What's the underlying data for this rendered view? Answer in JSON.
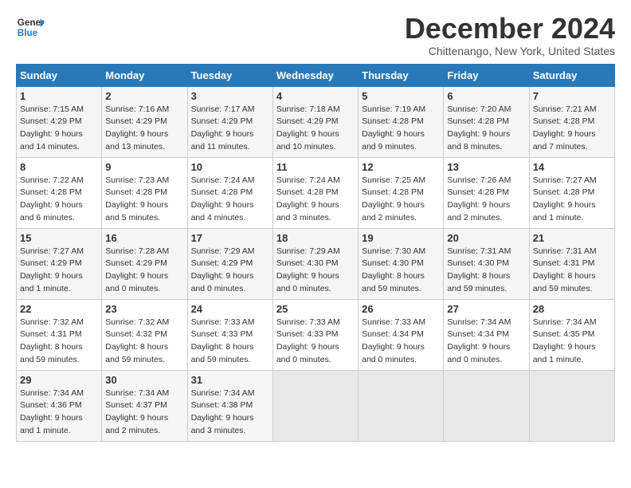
{
  "header": {
    "logo_line1": "General",
    "logo_line2": "Blue",
    "title": "December 2024",
    "subtitle": "Chittenango, New York, United States"
  },
  "days_of_week": [
    "Sunday",
    "Monday",
    "Tuesday",
    "Wednesday",
    "Thursday",
    "Friday",
    "Saturday"
  ],
  "weeks": [
    [
      {
        "day": "1",
        "sunrise": "7:15 AM",
        "sunset": "4:29 PM",
        "daylight": "9 hours and 14 minutes."
      },
      {
        "day": "2",
        "sunrise": "7:16 AM",
        "sunset": "4:29 PM",
        "daylight": "9 hours and 13 minutes."
      },
      {
        "day": "3",
        "sunrise": "7:17 AM",
        "sunset": "4:29 PM",
        "daylight": "9 hours and 11 minutes."
      },
      {
        "day": "4",
        "sunrise": "7:18 AM",
        "sunset": "4:29 PM",
        "daylight": "9 hours and 10 minutes."
      },
      {
        "day": "5",
        "sunrise": "7:19 AM",
        "sunset": "4:28 PM",
        "daylight": "9 hours and 9 minutes."
      },
      {
        "day": "6",
        "sunrise": "7:20 AM",
        "sunset": "4:28 PM",
        "daylight": "9 hours and 8 minutes."
      },
      {
        "day": "7",
        "sunrise": "7:21 AM",
        "sunset": "4:28 PM",
        "daylight": "9 hours and 7 minutes."
      }
    ],
    [
      {
        "day": "8",
        "sunrise": "7:22 AM",
        "sunset": "4:28 PM",
        "daylight": "9 hours and 6 minutes."
      },
      {
        "day": "9",
        "sunrise": "7:23 AM",
        "sunset": "4:28 PM",
        "daylight": "9 hours and 5 minutes."
      },
      {
        "day": "10",
        "sunrise": "7:24 AM",
        "sunset": "4:28 PM",
        "daylight": "9 hours and 4 minutes."
      },
      {
        "day": "11",
        "sunrise": "7:24 AM",
        "sunset": "4:28 PM",
        "daylight": "9 hours and 3 minutes."
      },
      {
        "day": "12",
        "sunrise": "7:25 AM",
        "sunset": "4:28 PM",
        "daylight": "9 hours and 2 minutes."
      },
      {
        "day": "13",
        "sunrise": "7:26 AM",
        "sunset": "4:28 PM",
        "daylight": "9 hours and 2 minutes."
      },
      {
        "day": "14",
        "sunrise": "7:27 AM",
        "sunset": "4:28 PM",
        "daylight": "9 hours and 1 minute."
      }
    ],
    [
      {
        "day": "15",
        "sunrise": "7:27 AM",
        "sunset": "4:29 PM",
        "daylight": "9 hours and 1 minute."
      },
      {
        "day": "16",
        "sunrise": "7:28 AM",
        "sunset": "4:29 PM",
        "daylight": "9 hours and 0 minutes."
      },
      {
        "day": "17",
        "sunrise": "7:29 AM",
        "sunset": "4:29 PM",
        "daylight": "9 hours and 0 minutes."
      },
      {
        "day": "18",
        "sunrise": "7:29 AM",
        "sunset": "4:30 PM",
        "daylight": "9 hours and 0 minutes."
      },
      {
        "day": "19",
        "sunrise": "7:30 AM",
        "sunset": "4:30 PM",
        "daylight": "8 hours and 59 minutes."
      },
      {
        "day": "20",
        "sunrise": "7:31 AM",
        "sunset": "4:30 PM",
        "daylight": "8 hours and 59 minutes."
      },
      {
        "day": "21",
        "sunrise": "7:31 AM",
        "sunset": "4:31 PM",
        "daylight": "8 hours and 59 minutes."
      }
    ],
    [
      {
        "day": "22",
        "sunrise": "7:32 AM",
        "sunset": "4:31 PM",
        "daylight": "8 hours and 59 minutes."
      },
      {
        "day": "23",
        "sunrise": "7:32 AM",
        "sunset": "4:32 PM",
        "daylight": "8 hours and 59 minutes."
      },
      {
        "day": "24",
        "sunrise": "7:33 AM",
        "sunset": "4:33 PM",
        "daylight": "8 hours and 59 minutes."
      },
      {
        "day": "25",
        "sunrise": "7:33 AM",
        "sunset": "4:33 PM",
        "daylight": "9 hours and 0 minutes."
      },
      {
        "day": "26",
        "sunrise": "7:33 AM",
        "sunset": "4:34 PM",
        "daylight": "9 hours and 0 minutes."
      },
      {
        "day": "27",
        "sunrise": "7:34 AM",
        "sunset": "4:34 PM",
        "daylight": "9 hours and 0 minutes."
      },
      {
        "day": "28",
        "sunrise": "7:34 AM",
        "sunset": "4:35 PM",
        "daylight": "9 hours and 1 minute."
      }
    ],
    [
      {
        "day": "29",
        "sunrise": "7:34 AM",
        "sunset": "4:36 PM",
        "daylight": "9 hours and 1 minute."
      },
      {
        "day": "30",
        "sunrise": "7:34 AM",
        "sunset": "4:37 PM",
        "daylight": "9 hours and 2 minutes."
      },
      {
        "day": "31",
        "sunrise": "7:34 AM",
        "sunset": "4:38 PM",
        "daylight": "9 hours and 3 minutes."
      },
      null,
      null,
      null,
      null
    ]
  ],
  "labels": {
    "sunrise": "Sunrise:",
    "sunset": "Sunset:",
    "daylight": "Daylight:"
  }
}
